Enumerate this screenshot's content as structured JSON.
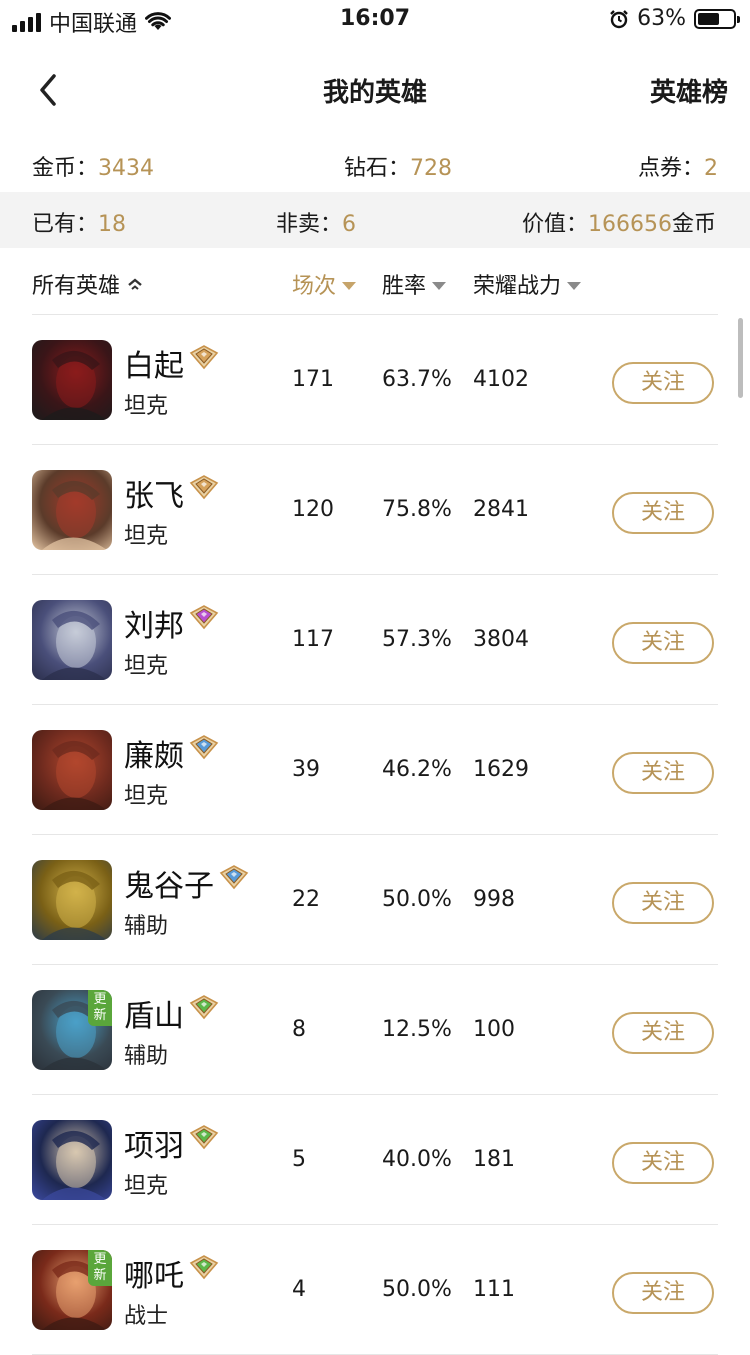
{
  "status_bar": {
    "carrier": "中国联通",
    "time": "16:07",
    "battery_percent": "63%",
    "battery_level": 0.63
  },
  "nav": {
    "title": "我的英雄",
    "right_label": "英雄榜"
  },
  "stats": {
    "gold_label": "金币：",
    "gold_value": "3434",
    "diamond_label": "钻石：",
    "diamond_value": "728",
    "voucher_label": "点券：",
    "voucher_value": "2",
    "owned_label": "已有：",
    "owned_value": "18",
    "notsale_label": "非卖：",
    "notsale_value": "6",
    "worth_label": "价值：",
    "worth_value": "166656",
    "worth_unit": "金币"
  },
  "sort_header": {
    "all_heroes": "所有英雄",
    "games": "场次",
    "win_rate": "胜率",
    "glory_power": "荣耀战力"
  },
  "colors": {
    "accent_gold": "#b69356",
    "new_badge": "#5aa63b",
    "rank_gold": "#d5a25c",
    "rank_purple": "#b84fd0",
    "rank_blue": "#5a9bd8",
    "rank_green": "#5db84a"
  },
  "heroes": [
    {
      "name": "白起",
      "role": "坦克",
      "games": "171",
      "win_rate": "63.7%",
      "power": "4102",
      "follow": "关注",
      "rank_gem": "gold",
      "is_new": false,
      "new_badge": ""
    },
    {
      "name": "张飞",
      "role": "坦克",
      "games": "120",
      "win_rate": "75.8%",
      "power": "2841",
      "follow": "关注",
      "rank_gem": "gold",
      "is_new": false,
      "new_badge": ""
    },
    {
      "name": "刘邦",
      "role": "坦克",
      "games": "117",
      "win_rate": "57.3%",
      "power": "3804",
      "follow": "关注",
      "rank_gem": "purple",
      "is_new": false,
      "new_badge": ""
    },
    {
      "name": "廉颇",
      "role": "坦克",
      "games": "39",
      "win_rate": "46.2%",
      "power": "1629",
      "follow": "关注",
      "rank_gem": "blue",
      "is_new": false,
      "new_badge": ""
    },
    {
      "name": "鬼谷子",
      "role": "辅助",
      "games": "22",
      "win_rate": "50.0%",
      "power": "998",
      "follow": "关注",
      "rank_gem": "blue",
      "is_new": false,
      "new_badge": ""
    },
    {
      "name": "盾山",
      "role": "辅助",
      "games": "8",
      "win_rate": "12.5%",
      "power": "100",
      "follow": "关注",
      "rank_gem": "green",
      "is_new": true,
      "new_badge": "更新"
    },
    {
      "name": "项羽",
      "role": "坦克",
      "games": "5",
      "win_rate": "40.0%",
      "power": "181",
      "follow": "关注",
      "rank_gem": "green",
      "is_new": false,
      "new_badge": ""
    },
    {
      "name": "哪吒",
      "role": "战士",
      "games": "4",
      "win_rate": "50.0%",
      "power": "111",
      "follow": "关注",
      "rank_gem": "green",
      "is_new": true,
      "new_badge": "更新"
    }
  ]
}
